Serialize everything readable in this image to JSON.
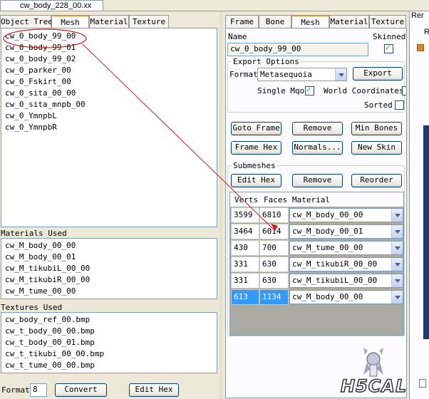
{
  "window": {
    "title": "cw_body_228_00.xx"
  },
  "left_tabs": [
    "Object Tree",
    "Mesh",
    "Material",
    "Texture"
  ],
  "mesh_list": [
    "cw_0_body_99_00",
    "cw_0_body_99_01",
    "cw_0_body_99_02",
    "cw_0_parker_00",
    "cw_0_Fskirt_00",
    "cw_0_sita_00_00",
    "cw_0_sita_mnpb_00",
    "cw_0_YmnpbL",
    "cw_0_YmnpbR"
  ],
  "materials_used": {
    "label": "Materials Used",
    "items": [
      "cw_M_body_00_00",
      "cw_M_body_00_01",
      "cw_M_tikubiL_00_00",
      "cw_M_tikubiR_00_00",
      "cw_M_tume_00_00"
    ]
  },
  "textures_used": {
    "label": "Textures Used",
    "items": [
      "cw_body_ref_00.bmp",
      "cw_t_body_00_00.bmp",
      "cw_t_body_00_01.bmp",
      "cw_t_tikubi_00_00.bmp",
      "cw_t_tume_00_00.bmp"
    ]
  },
  "bottom_bar": {
    "format_label": "Format",
    "format_value": "8",
    "convert": "Convert",
    "edit_hex": "Edit Hex"
  },
  "right_tabs": [
    "Frame",
    "Bone",
    "Mesh",
    "Material",
    "Texture"
  ],
  "mesh_panel": {
    "name_label": "Name",
    "name_value": "cw_0_body_99_00",
    "skinned_label": "Skinned",
    "skinned": true,
    "export_options_label": "Export Options",
    "format_label": "Format",
    "format_value": "Metasequoia",
    "export_button": "Export",
    "single_mqo_label": "Single Mqo",
    "single_mqo": true,
    "world_coords_label": "World Coordinates",
    "sorted_label": "Sorted",
    "sorted": false,
    "goto_frame": "Goto Frame",
    "remove": "Remove",
    "min_bones": "Min Bones",
    "frame_hex": "Frame Hex",
    "normals": "Normals...",
    "new_skin": "New Skin",
    "submeshes_label": "Submeshes",
    "edit_hex": "Edit Hex",
    "remove2": "Remove",
    "reorder": "Reorder",
    "columns": [
      "Verts",
      "Faces",
      "Material"
    ],
    "rows": [
      {
        "verts": "3599",
        "faces": "6810",
        "material": "cw_M_body_00_00"
      },
      {
        "verts": "3464",
        "faces": "6014",
        "material": "cw_M_body_00_01"
      },
      {
        "verts": "430",
        "faces": "700",
        "material": "cw_M_tume_00_00"
      },
      {
        "verts": "331",
        "faces": "630",
        "material": "cw_M_tikubiR_00_00"
      },
      {
        "verts": "331",
        "faces": "630",
        "material": "cw_M_tikubiL_00_00"
      },
      {
        "verts": "613",
        "faces": "1134",
        "material": "cw_M_body_00_00"
      }
    ]
  },
  "edge_text": {
    "top": "Rer",
    "side": "Re"
  },
  "watermark": "H5CAL"
}
